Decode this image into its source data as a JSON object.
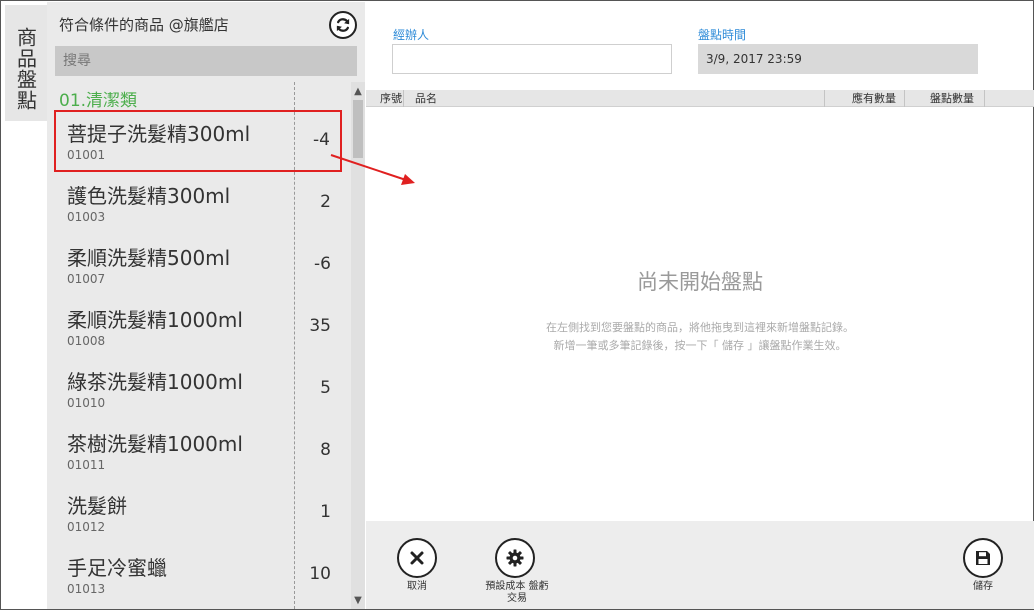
{
  "vertical_tab": {
    "label": "商品盤點"
  },
  "left_panel": {
    "title": "符合條件的商品 @旗艦店",
    "search_placeholder": "搜尋",
    "category": "01.清潔類",
    "products": [
      {
        "name": "菩提子洗髮精300ml",
        "code": "01001",
        "qty": "-4"
      },
      {
        "name": "護色洗髮精300ml",
        "code": "01003",
        "qty": "2"
      },
      {
        "name": "柔順洗髮精500ml",
        "code": "01007",
        "qty": "-6"
      },
      {
        "name": "柔順洗髮精1000ml",
        "code": "01008",
        "qty": "35"
      },
      {
        "name": "綠茶洗髮精1000ml",
        "code": "01010",
        "qty": "5"
      },
      {
        "name": "茶樹洗髮精1000ml",
        "code": "01011",
        "qty": "8"
      },
      {
        "name": "洗髮餅",
        "code": "01012",
        "qty": "1"
      },
      {
        "name": "手足冷蜜蠟",
        "code": "01013",
        "qty": "10"
      }
    ]
  },
  "form": {
    "operator_label": "經辦人",
    "operator_value": "",
    "time_label": "盤點時間",
    "time_value": "3/9, 2017 23:59"
  },
  "table": {
    "col_seq": "序號",
    "col_name": "品名",
    "col_stock": "應有數量",
    "col_count": "盤點數量"
  },
  "empty_state": {
    "title": "尚未開始盤點",
    "hint_line1": "在左側找到您要盤點的商品，將他拖曳到這裡來新增盤點記錄。",
    "hint_line2": "新增一筆或多筆記錄後，按一下「 儲存 」讓盤點作業生效。"
  },
  "actions": {
    "cancel": "取消",
    "cost_line1": "預設成本 盤虧",
    "cost_line2": "交易",
    "save": "儲存"
  },
  "colors": {
    "accent_blue": "#2e8bd8",
    "category_green": "#4cae4c",
    "highlight_red": "#e02020"
  }
}
